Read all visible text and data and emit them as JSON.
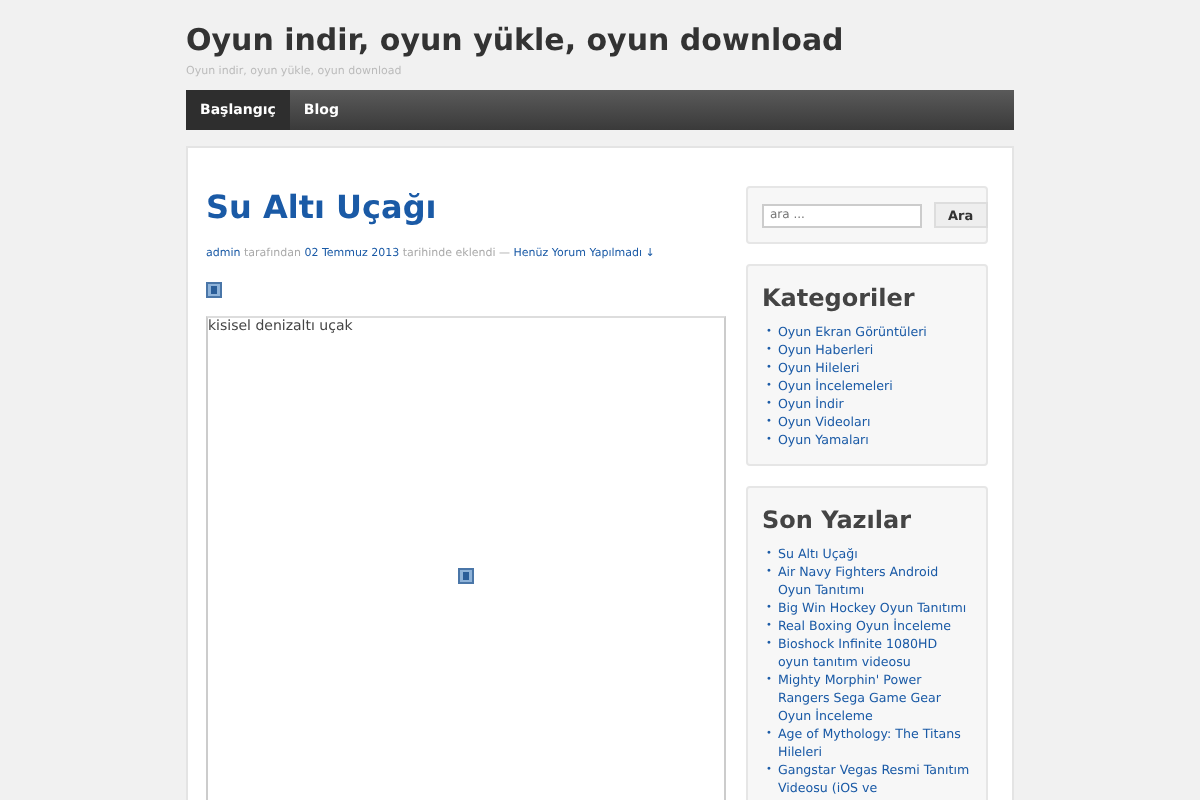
{
  "site": {
    "title": "Oyun indir, oyun yükle, oyun download",
    "tagline": "Oyun indir, oyun yükle, oyun download"
  },
  "nav": [
    {
      "label": "Başlangıç",
      "selected": true
    },
    {
      "label": "Blog",
      "selected": false
    }
  ],
  "post": {
    "title": "Su Altı Uçağı",
    "meta": [
      {
        "kind": "link",
        "text": "admin"
      },
      {
        "kind": "text",
        "text": "tarafından"
      },
      {
        "kind": "link",
        "text": "02 Temmuz 2013"
      },
      {
        "kind": "text",
        "text": "tarihinde eklendi —"
      },
      {
        "kind": "link",
        "text": "Henüz Yorum Yapılmadı ↓"
      }
    ],
    "image_alt": "kisisel denizaltı uçak"
  },
  "search": {
    "placeholder": "ara ...",
    "button": "Ara"
  },
  "widgets": [
    {
      "title": "Kategoriler",
      "bullet": "•",
      "items": [
        "Oyun Ekran Görüntüleri",
        "Oyun Haberleri",
        "Oyun Hileleri",
        "Oyun İncelemeleri",
        "Oyun İndir",
        "Oyun Videoları",
        "Oyun Yamaları"
      ]
    },
    {
      "title": "Son Yazılar",
      "bullet": "•",
      "items": [
        "Su Altı Uçağı",
        "Air Navy Fighters Android Oyun Tanıtımı",
        "Big Win Hockey Oyun Tanıtımı",
        "Real Boxing Oyun İnceleme",
        "Bioshock Infinite 1080HD oyun tanıtım videosu",
        "Mighty Morphin' Power Rangers Sega Game Gear Oyun İnceleme",
        "Age of Mythology: The Titans Hileleri",
        "Gangstar Vegas Resmi Tanıtım Videosu (iOS ve"
      ]
    }
  ]
}
